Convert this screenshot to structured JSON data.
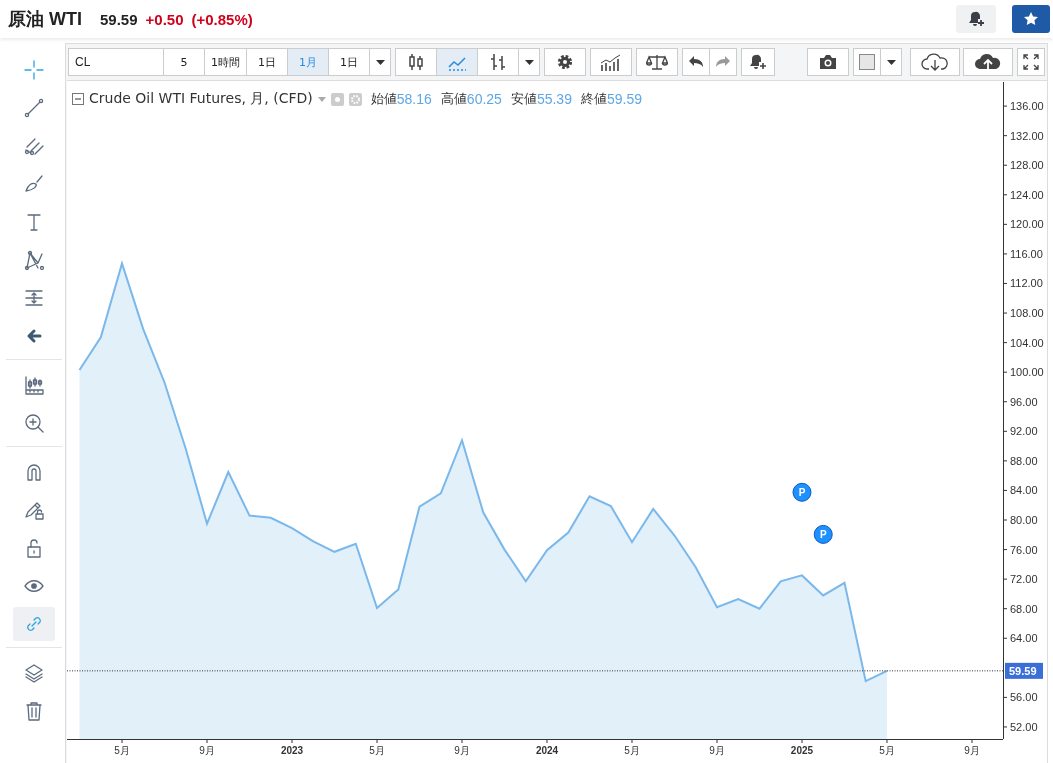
{
  "header": {
    "title": "原油 WTI",
    "price": "59.59",
    "change": "+0.50",
    "change_percent": "(+0.85%)"
  },
  "sidebar": {
    "tool_groups": [
      [
        {
          "selected": true
        },
        {
          "selected": false
        },
        {
          "selected": false
        },
        {
          "selected": false
        },
        {
          "selected": false
        },
        {
          "selected": false
        },
        {
          "selected": false
        },
        {
          "selected": false
        }
      ],
      [
        {
          "selected": false
        },
        {
          "selected": false
        }
      ],
      [
        {
          "selected": false
        },
        {
          "selected": false
        },
        {
          "selected": false
        },
        {
          "selected": false
        },
        {
          "selected": true
        }
      ],
      [
        {
          "selected": false
        },
        {
          "selected": false
        }
      ]
    ]
  },
  "toolbar": {
    "symbol": "CL",
    "intervals": [
      {
        "label": "5",
        "selected": false
      },
      {
        "label": "1時間",
        "selected": false
      },
      {
        "label": "1日",
        "selected": false
      },
      {
        "label": "1月",
        "selected": true
      }
    ],
    "range": "1日",
    "chart_types": [
      {
        "selected": false
      },
      {
        "selected": true
      },
      {
        "selected": false
      }
    ]
  },
  "chart": {
    "legend": {
      "title": "Crude Oil WTI Futures, 月, (CFD)",
      "ohlc": [
        {
          "label": "始値",
          "value": "58.16"
        },
        {
          "label": "高値",
          "value": "60.25"
        },
        {
          "label": "安値",
          "value": "55.39"
        },
        {
          "label": "終値",
          "value": "59.59"
        }
      ]
    },
    "event_markers": [
      {
        "text": "P"
      },
      {
        "text": "P"
      }
    ],
    "chart_data": {
      "type": "area",
      "categories": [
        null,
        null,
        null,
        "5月",
        null,
        null,
        null,
        "9月",
        null,
        null,
        null,
        "2023",
        null,
        null,
        null,
        "5月",
        null,
        null,
        null,
        "9月",
        null,
        null,
        null,
        "2024",
        null,
        null,
        null,
        "5月",
        null,
        null,
        null,
        "9月",
        null,
        null,
        null,
        "2025",
        null,
        null,
        null,
        "5月",
        null,
        null,
        null,
        "9月"
      ],
      "series": [
        {
          "color": "#7ab8ec",
          "values": [
            null,
            100.3,
            104.7,
            114.7,
            105.8,
            98.6,
            89.6,
            79.5,
            86.5,
            80.6,
            80.3,
            78.9,
            77.1,
            75.7,
            76.8,
            68.1,
            70.6,
            81.8,
            83.6,
            90.8,
            81.0,
            76.0,
            71.7,
            75.9,
            78.3,
            83.2,
            81.9,
            77.0,
            81.5,
            77.9,
            73.6,
            68.2,
            69.3,
            68.0,
            71.7,
            72.5,
            69.8,
            71.5,
            58.2,
            59.6,
            null,
            null,
            null,
            null
          ]
        }
      ],
      "ylim": [
        50.37,
        139.26
      ],
      "ref_lines": [
        {
          "axis": "y",
          "value": 59.59,
          "label": "59.59"
        }
      ],
      "yticks": [
        {
          "value": 52,
          "label": "52.00"
        },
        {
          "value": 56,
          "label": "56.00"
        },
        {
          "value": 64,
          "label": "64.00"
        },
        {
          "value": 68,
          "label": "68.00"
        },
        {
          "value": 72,
          "label": "72.00"
        },
        {
          "value": 76,
          "label": "76.00"
        },
        {
          "value": 80,
          "label": "80.00"
        },
        {
          "value": 84,
          "label": "84.00"
        },
        {
          "value": 88,
          "label": "88.00"
        },
        {
          "value": 92,
          "label": "92.00"
        },
        {
          "value": 96,
          "label": "96.00"
        },
        {
          "value": 100,
          "label": "100.00"
        },
        {
          "value": 104,
          "label": "104.00"
        },
        {
          "value": 108,
          "label": "108.00"
        },
        {
          "value": 112,
          "label": "112.00"
        },
        {
          "value": 116,
          "label": "116.00"
        },
        {
          "value": 120,
          "label": "120.00"
        },
        {
          "value": 124,
          "label": "124.00"
        },
        {
          "value": 128,
          "label": "128.00"
        },
        {
          "value": 132,
          "label": "132.00"
        },
        {
          "value": 136,
          "label": "136.00"
        }
      ]
    }
  }
}
